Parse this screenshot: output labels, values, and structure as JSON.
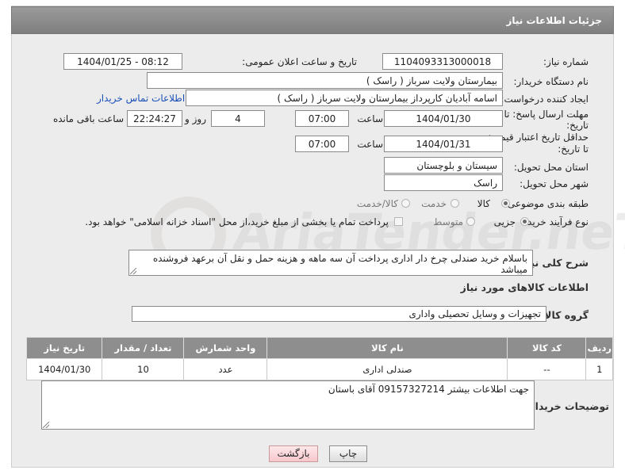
{
  "header": {
    "title": "جزئیات اطلاعات نیاز"
  },
  "fields": {
    "need_number_label": "شماره نیاز:",
    "need_number": "1104093313000018",
    "announce_label": "تاریخ و ساعت اعلان عمومی:",
    "announce_value": "1404/01/25 - 08:12",
    "buyer_org_label": "نام دستگاه خریدار:",
    "buyer_org": "بیمارستان ولایت سرباز ( راسک )",
    "requester_label": "ایجاد کننده درخواست:",
    "requester": "اسامه آبادیان کارپرداز بیمارستان ولایت سرباز ( راسک )",
    "contact_link": "اطلاعات تماس خریدار",
    "reply_deadline_label_1": "مهلت ارسال پاسخ: تا",
    "reply_deadline_label_2": "تاریخ:",
    "reply_date": "1404/01/30",
    "hour_label": "ساعت",
    "reply_time": "07:00",
    "days": "4",
    "days_and_label": "روز و",
    "remaining_time": "22:24:27",
    "remaining_label": "ساعت باقی مانده",
    "price_validity_label_1": "حداقل تاریخ اعتبار قیمت:",
    "price_validity_label_2": "تا تاریخ:",
    "price_date": "1404/01/31",
    "price_time": "07:00",
    "province_label": "استان محل تحویل:",
    "province": "سیستان و بلوچستان",
    "city_label": "شهر محل تحویل:",
    "city": "راسک",
    "category_label": "طبقه بندی موضوعی:",
    "category_options": [
      "کالا",
      "خدمت",
      "کالا/خدمت"
    ],
    "purchase_type_label": "نوع فرآیند خرید :",
    "purchase_options": [
      "جزیی",
      "متوسط"
    ],
    "payment_note": "پرداخت تمام یا بخشی از مبلغ خرید،از محل \"اسناد خزانه اسلامی\" خواهد بود."
  },
  "description": {
    "label": "شرح کلی نیاز:",
    "text": "باسلام خرید صندلی چرخ دار اداری  پرداخت آن سه ماهه و هزینه حمل و نقل آن برعهد فروشنده میباشد"
  },
  "goods": {
    "section_title": "اطلاعات کالاهای مورد نیاز",
    "group_label": "گروه کالا:",
    "group_value": "تجهیزات و وسایل تحصیلی واداری",
    "columns": [
      "ردیف",
      "کد کالا",
      "نام کالا",
      "واحد شمارش",
      "تعداد / مقدار",
      "تاریخ نیاز"
    ],
    "rows": [
      [
        "1",
        "--",
        "صندلی اداری",
        "عدد",
        "10",
        "1404/01/30"
      ]
    ]
  },
  "buyer_notes": {
    "label": "توضیحات خریدار:",
    "text": "جهت اطلاعات بیشتر  09157327214 آقای باستان"
  },
  "buttons": {
    "print": "چاپ",
    "back": "بازگشت"
  },
  "watermark": {
    "text": "AriaTender.neT",
    "color": "#c8c8c8"
  }
}
